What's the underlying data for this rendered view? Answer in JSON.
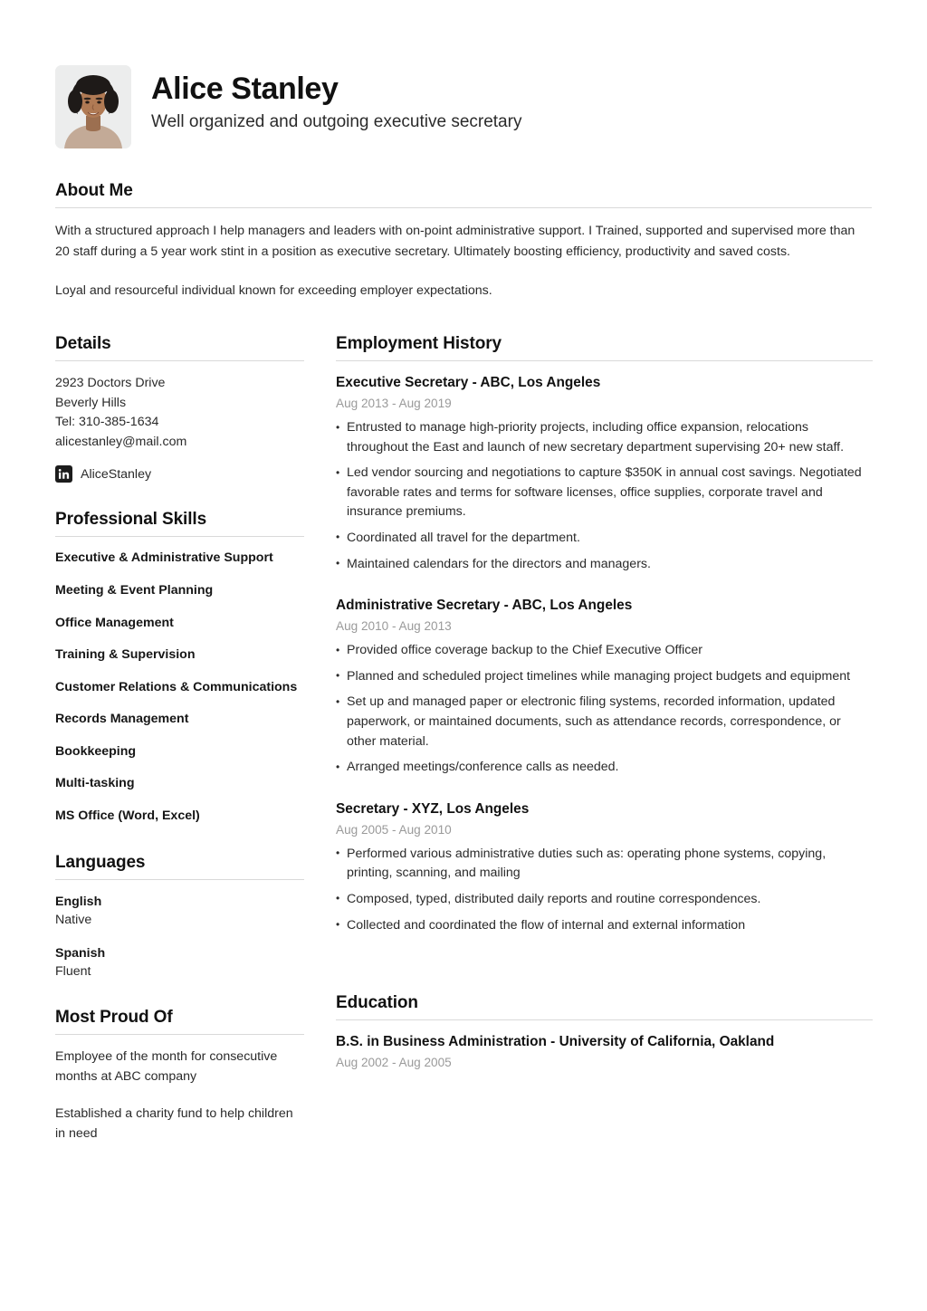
{
  "header": {
    "name": "Alice Stanley",
    "headline": "Well organized and outgoing executive secretary",
    "photo_alt": "profile-photo"
  },
  "about": {
    "heading": "About Me",
    "paragraphs": [
      "With a structured approach I help managers and leaders with on-point administrative support. I Trained, supported and supervised more than 20 staff during a 5 year work stint in a position as executive secretary. Ultimately boosting efficiency, productivity and saved costs.",
      "Loyal and resourceful individual known for exceeding employer expectations."
    ]
  },
  "details": {
    "heading": "Details",
    "lines": [
      "2923 Doctors Drive",
      "Beverly Hills",
      "Tel: 310-385-1634",
      "alicestanley@mail.com"
    ],
    "social": {
      "icon": "linkedin-icon",
      "handle": "AliceStanley"
    }
  },
  "skills": {
    "heading": "Professional Skills",
    "items": [
      "Executive & Administrative Support",
      "Meeting & Event Planning",
      "Office Management",
      "Training & Supervision",
      "Customer Relations & Communications",
      "Records Management",
      "Bookkeeping",
      "Multi-tasking",
      "MS Office (Word, Excel)"
    ]
  },
  "languages": {
    "heading": "Languages",
    "items": [
      {
        "name": "English",
        "level": "Native"
      },
      {
        "name": "Spanish",
        "level": "Fluent"
      }
    ]
  },
  "proud": {
    "heading": "Most Proud Of",
    "items": [
      "Employee of the month for consecutive months at ABC company",
      "Established a charity fund to help children in need"
    ]
  },
  "employment": {
    "heading": "Employment History",
    "jobs": [
      {
        "title": "Executive Secretary - ABC, Los Angeles",
        "dates": "Aug 2013 - Aug 2019",
        "bullets": [
          "Entrusted to manage high-priority projects, including office expansion, relocations throughout the East and launch of new secretary department supervising 20+ new staff.",
          "Led vendor sourcing and negotiations to capture $350K in annual cost savings. Negotiated favorable rates and terms for software licenses, office supplies, corporate travel and insurance premiums.",
          "Coordinated all travel for the department.",
          "Maintained calendars for the directors and managers."
        ]
      },
      {
        "title": "Administrative Secretary - ABC, Los Angeles",
        "dates": "Aug 2010 - Aug 2013",
        "bullets": [
          "Provided office coverage backup to the Chief Executive Officer",
          "Planned and scheduled project timelines while managing project budgets and equipment",
          "Set up and managed paper or electronic filing systems, recorded information, updated paperwork, or maintained documents, such as attendance records, correspondence, or other material.",
          "Arranged meetings/conference calls as needed."
        ]
      },
      {
        "title": "Secretary - XYZ, Los Angeles",
        "dates": "Aug 2005 - Aug 2010",
        "bullets": [
          "Performed various administrative duties such as: operating phone systems, copying, printing, scanning, and mailing",
          "Composed, typed, distributed daily reports and routine correspondences.",
          "Collected and coordinated the flow of internal and external information"
        ]
      }
    ]
  },
  "education": {
    "heading": "Education",
    "items": [
      {
        "title": "B.S. in Business Administration - University of California, Oakland",
        "dates": "Aug 2002 - Aug 2005"
      }
    ]
  },
  "colors": {
    "text": "#1c1c1c",
    "muted": "#9a9a9a",
    "rule": "#d9d9d9",
    "background": "#ffffff"
  }
}
